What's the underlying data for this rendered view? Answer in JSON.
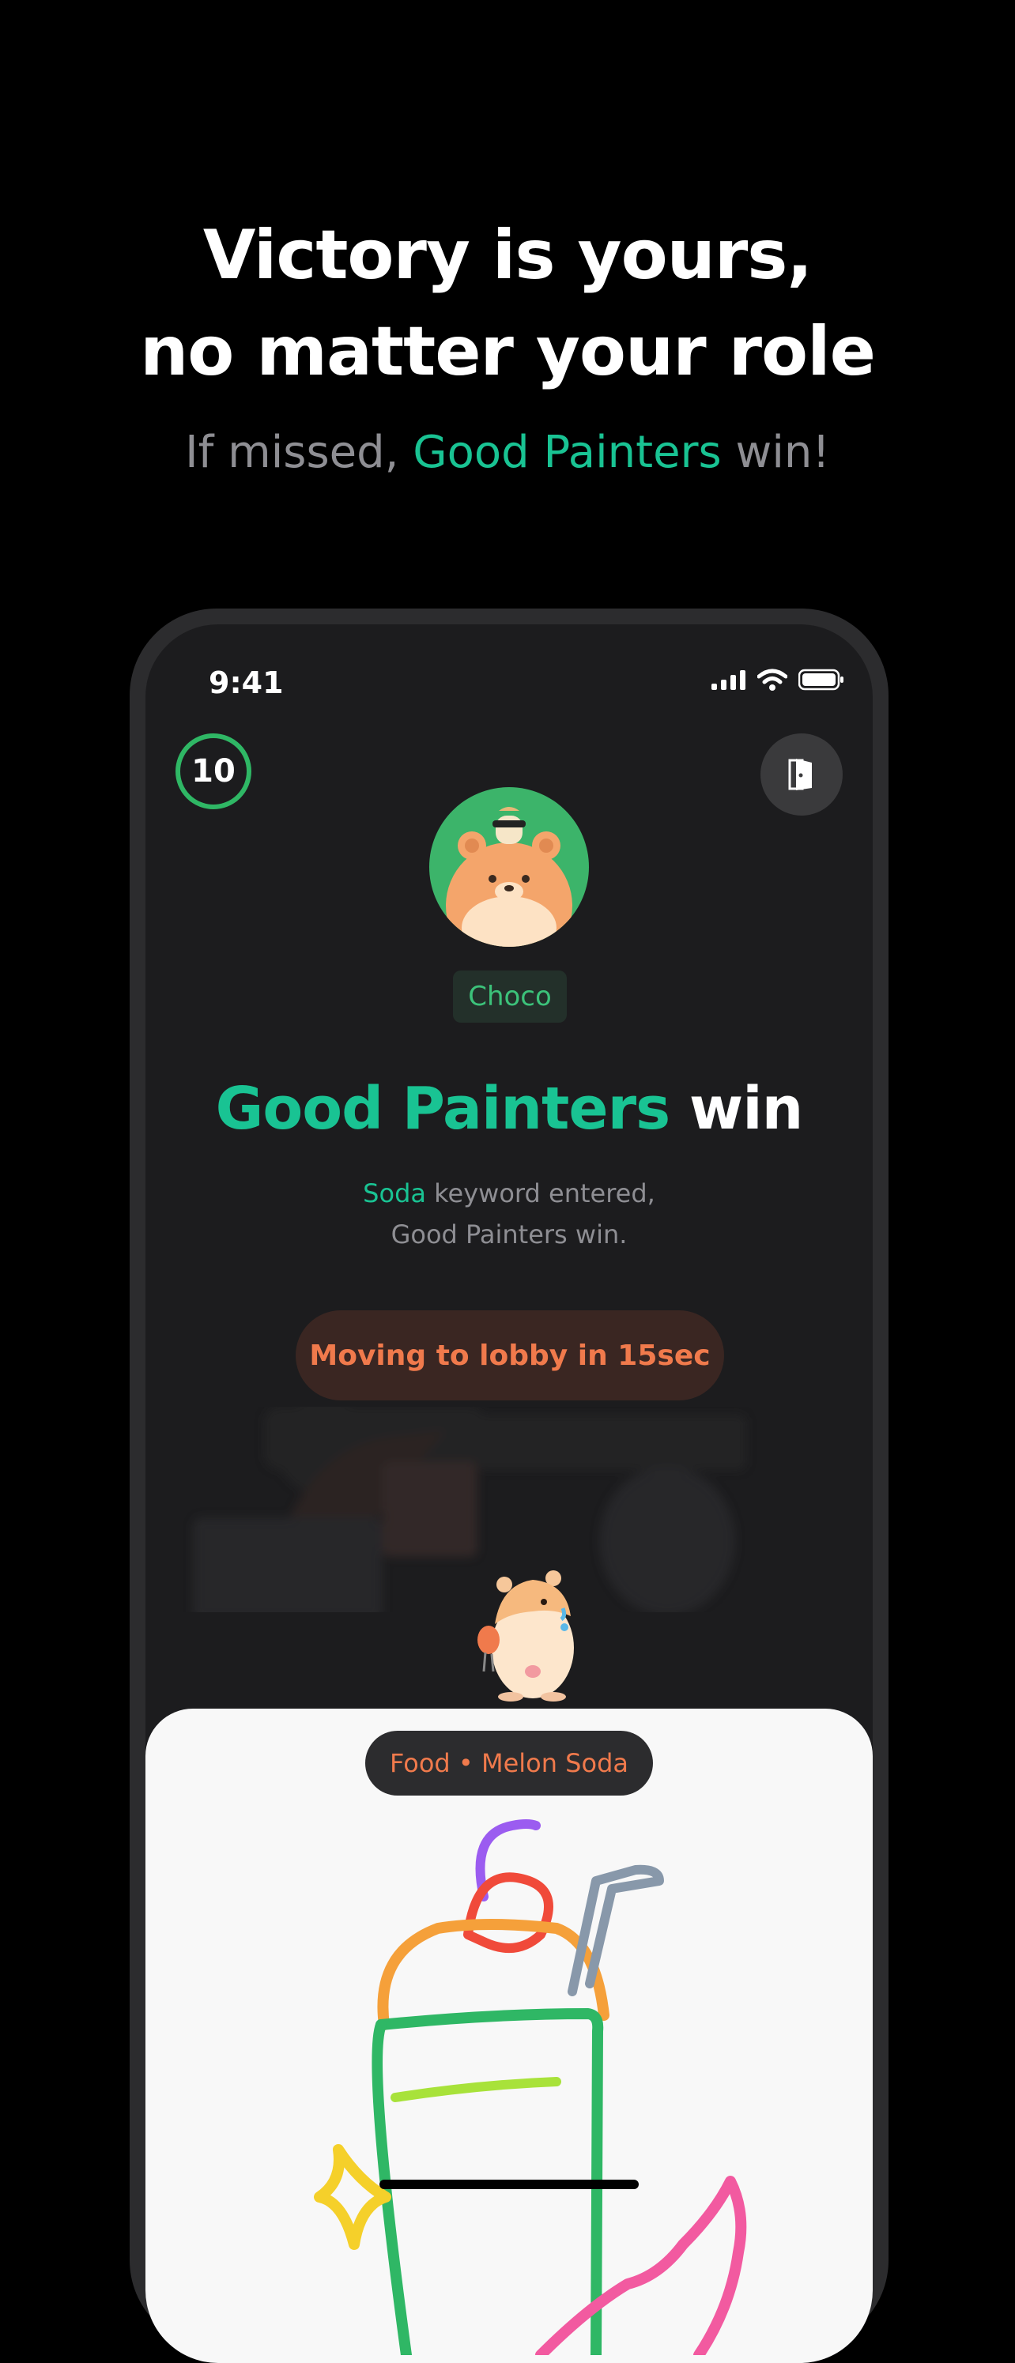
{
  "promo": {
    "headline_line1": "Victory is yours,",
    "headline_line2": "no matter your role",
    "sub_prefix": "If missed, ",
    "sub_accent": "Good Painters",
    "sub_suffix": " win!"
  },
  "status_bar": {
    "time": "9:41"
  },
  "game": {
    "timer": "10",
    "player_name": "Choco",
    "result_accent": "Good Painters",
    "result_rest": " win",
    "desc_keyword": "Soda",
    "desc_line1_rest": " keyword entered,",
    "desc_line2": "Good Painters win.",
    "lobby_button": "Moving to lobby in 15sec",
    "topic": "Food • Melon Soda"
  },
  "colors": {
    "accent": "#19c393",
    "timer_ring": "#2fb765",
    "orange": "#f07a4c"
  }
}
